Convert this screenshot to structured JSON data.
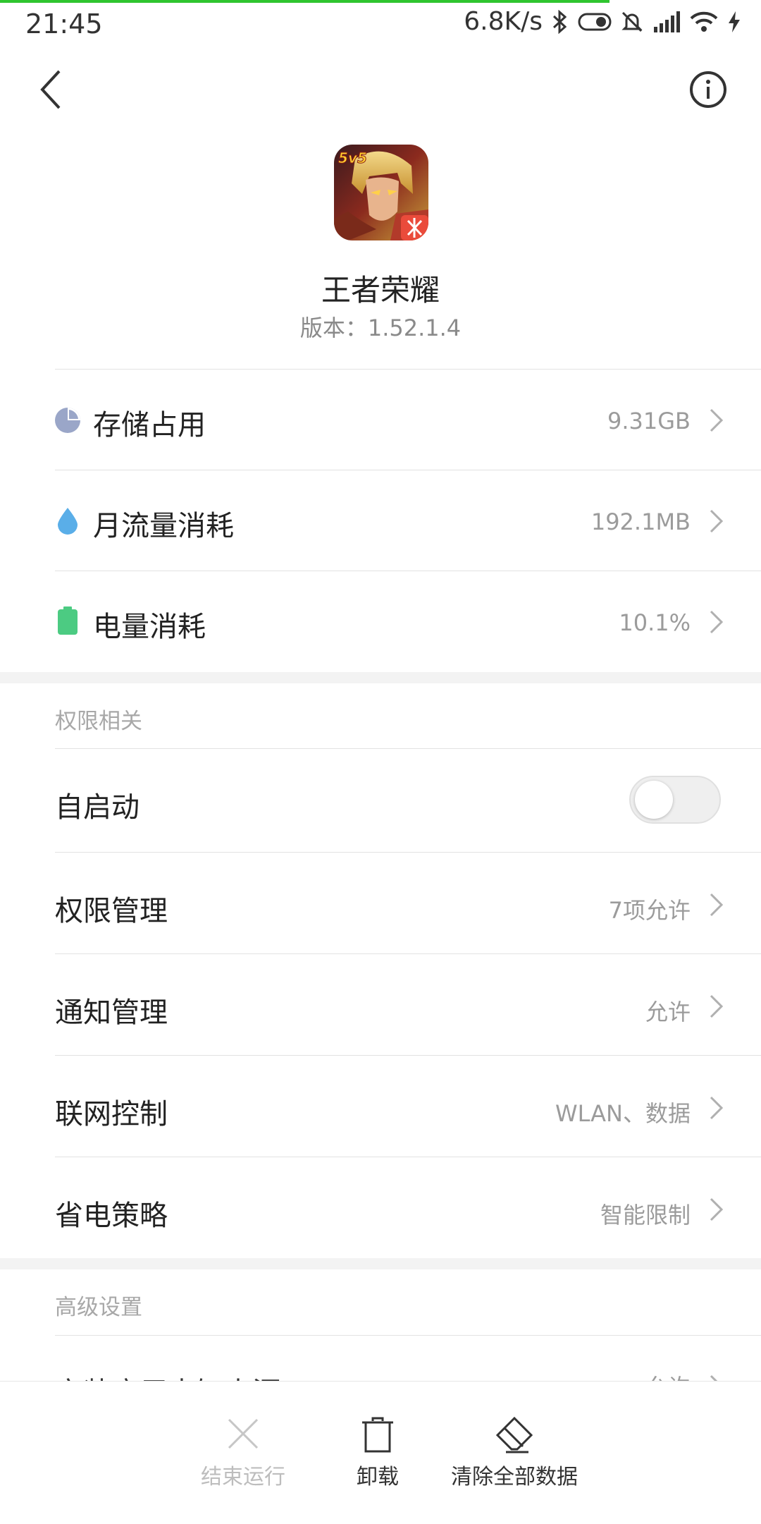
{
  "status_bar": {
    "time": "21:45",
    "net_speed": "6.8K/s",
    "icons": [
      "bluetooth-icon",
      "toggle-icon",
      "mute-bell-icon",
      "signal-icon",
      "wifi-icon",
      "charging-icon"
    ]
  },
  "app": {
    "name": "王者荣耀",
    "version": "版本：1.52.1.4",
    "icon_badge": "5v5"
  },
  "usage": [
    {
      "label": "存储占用",
      "value": "9.31GB",
      "icon": "storage-pie-icon"
    },
    {
      "label": "月流量消耗",
      "value": "192.1MB",
      "icon": "data-drop-icon"
    },
    {
      "label": "电量消耗",
      "value": "10.1%",
      "icon": "battery-icon"
    }
  ],
  "permissions": {
    "section_title": "权限相关",
    "autostart": {
      "label": "自启动",
      "enabled": false
    },
    "items": [
      {
        "label": "权限管理",
        "value": "7项允许"
      },
      {
        "label": "通知管理",
        "value": "允许"
      },
      {
        "label": "联网控制",
        "value": "WLAN、数据"
      },
      {
        "label": "省电策略",
        "value": "智能限制"
      }
    ]
  },
  "advanced": {
    "section_title": "高级设置",
    "items": [
      {
        "label": "安装应用未知来源",
        "value": "允许"
      }
    ]
  },
  "actions": [
    {
      "label": "结束运行",
      "icon": "close-icon",
      "enabled": false
    },
    {
      "label": "卸载",
      "icon": "trash-icon",
      "enabled": true
    },
    {
      "label": "清除全部数据",
      "icon": "eraser-icon",
      "enabled": true
    }
  ],
  "colors": {
    "accent": "#2fc52f",
    "storage_icon": "#9aa6c8",
    "data_icon": "#5aaee8",
    "battery_icon": "#4ccb82"
  }
}
